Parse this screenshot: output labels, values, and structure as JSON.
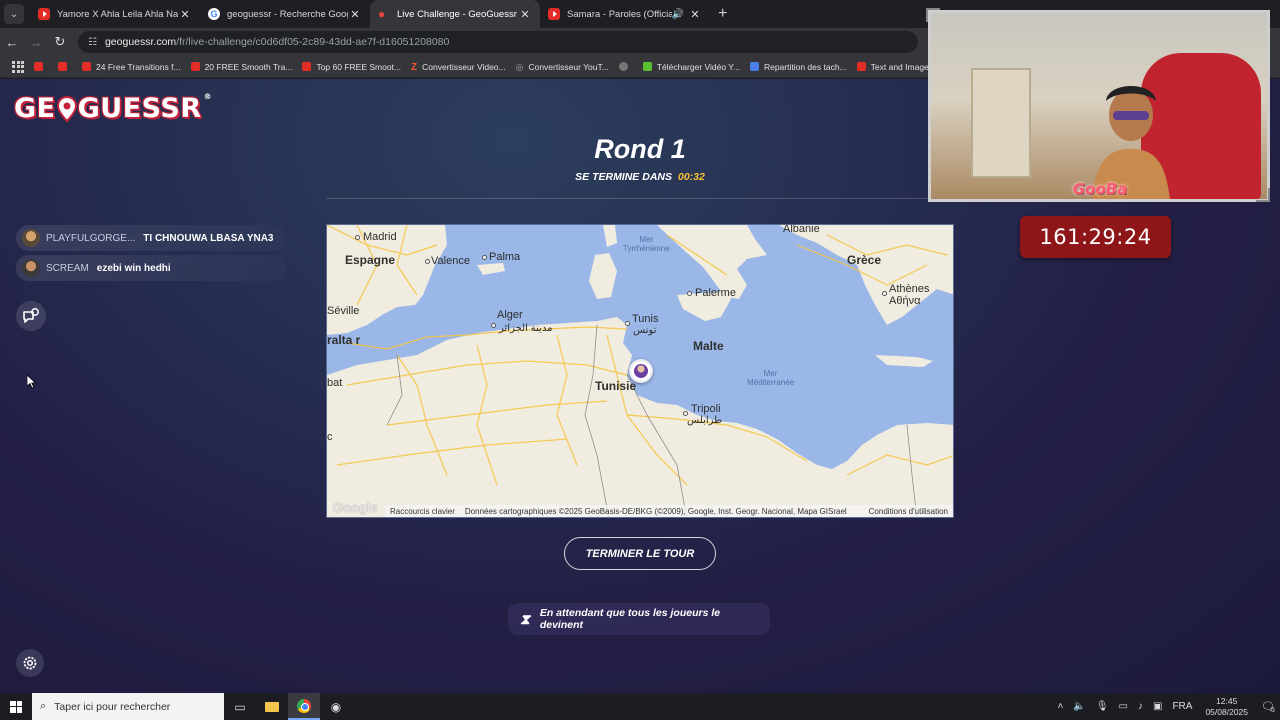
{
  "browser": {
    "tabs": [
      {
        "title": "Yamore X Ahla Leila Ahla Nas (I",
        "favicon": "youtube-icon",
        "active": false
      },
      {
        "title": "geoguessr - Recherche Google",
        "favicon": "google-icon",
        "active": false
      },
      {
        "title": "Live Challenge - GeoGuessr",
        "favicon": "geoguessr-icon",
        "active": true
      },
      {
        "title": "Samara - Paroles (Official M",
        "favicon": "youtube-icon",
        "active": false
      }
    ],
    "url_host": "geoguessr.com",
    "url_path": "/fr/live-challenge/c0d6df05-2c89-43dd-ae7f-d16051208080",
    "bookmarks": [
      {
        "label": "",
        "icon": "youtube"
      },
      {
        "label": "",
        "icon": "youtube"
      },
      {
        "label": "24 Free Transitions f...",
        "icon": "youtube"
      },
      {
        "label": "20 FREE Smooth Tra...",
        "icon": "youtube"
      },
      {
        "label": "Top 60 FREE Smoot...",
        "icon": "youtube"
      },
      {
        "label": "Convertisseur Video...",
        "icon": "z"
      },
      {
        "label": "Convertisseur YouT...",
        "icon": "c"
      },
      {
        "label": "",
        "icon": "globe"
      },
      {
        "label": "Télécharger Vidéo Y...",
        "icon": "download"
      },
      {
        "label": "Repartition des tach...",
        "icon": "doc"
      },
      {
        "label": "Text and Image ani...",
        "icon": "youtube"
      }
    ]
  },
  "game": {
    "logo": "GEOGUESSR",
    "round_title": "Rond 1",
    "ends_in_label": "SE TERMINE DANS",
    "countdown": "00:32",
    "chat": [
      {
        "user": "PLAYFULGORGE...",
        "message": "TI CHNOUWA LBASA YNA3"
      },
      {
        "user": "SCREAM",
        "message": "ezebi win hedhi"
      }
    ],
    "finish_button": "TERMINER LE TOUR",
    "waiting_text": "En attendant que tous les joueurs le devinent"
  },
  "map": {
    "labels": {
      "madrid": "Madrid",
      "espagne": "Espagne",
      "valence": "Valence",
      "palma": "Palma",
      "seville": "Séville",
      "gibraltar": "ralta r",
      "rabat": "bat",
      "c": "c",
      "alger": "Alger",
      "alger_ar": "مدينة الجزائر",
      "tunis": "Tunis",
      "tunis_ar": "تونس",
      "tunisie": "Tunisie",
      "palerme": "Palerme",
      "malte": "Malte",
      "tripoli": "Tripoli",
      "tripoli_ar": "طرابلس",
      "albanie": "Albanie",
      "grece": "Grèce",
      "athenes": "Athènes",
      "athenes_gr": "Αθήνα",
      "mer_tyrrhenienne": "Mer\nTyrrhénienne",
      "mer_mediterranee": "Mer\nMéditerranée"
    },
    "google_logo": "Google",
    "shortcuts": "Raccourcis clavier",
    "attribution": "Données cartographiques ©2025 GeoBasis-DE/BKG (©2009), Google, Inst. Geogr. Nacional, Mapa GISrael",
    "terms": "Conditions d'utilisation"
  },
  "stream": {
    "streamer_name": "GooBa",
    "session_timer": "161:29:24"
  },
  "taskbar": {
    "search_placeholder": "Taper ici pour rechercher",
    "language": "FRA",
    "time": "12:45",
    "date": "05/08/2025",
    "notification_count": "5"
  },
  "colors": {
    "countdown": "#f6c431",
    "stream_timer_bg": "#8e1518",
    "logo_red": "#c3223a"
  }
}
